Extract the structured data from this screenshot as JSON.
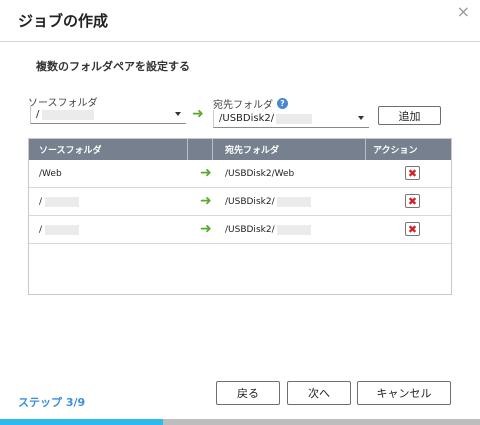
{
  "dialog": {
    "title": "ジョブの作成",
    "close_glyph": "×"
  },
  "section": {
    "heading": "複数のフォルダペアを設定する"
  },
  "source": {
    "label": "ソースフォルダ",
    "selected": "/"
  },
  "destination": {
    "label": "宛先フォルダ",
    "help_glyph": "?",
    "selected": "/USBDisk2/"
  },
  "add_button": "追加",
  "arrow_glyph": "➜",
  "table": {
    "headers": {
      "source": "ソースフォルダ",
      "destination": "宛先フォルダ",
      "action": "アクション"
    },
    "rows": [
      {
        "source": "/Web",
        "destination": "/USBDisk2/Web"
      },
      {
        "source": "/",
        "destination": "/USBDisk2/"
      },
      {
        "source": "/",
        "destination": "/USBDisk2/"
      }
    ],
    "delete_glyph": "✖"
  },
  "footer": {
    "step": "ステップ 3/9",
    "back": "戻る",
    "next": "次へ",
    "cancel": "キャンセル"
  },
  "progress": {
    "fraction": 0.34
  },
  "colors": {
    "accent": "#3a8de0",
    "progress": "#2fb9ec",
    "arrow": "#5aaa2a",
    "table_header": "#76808e",
    "delete": "#d32020"
  }
}
